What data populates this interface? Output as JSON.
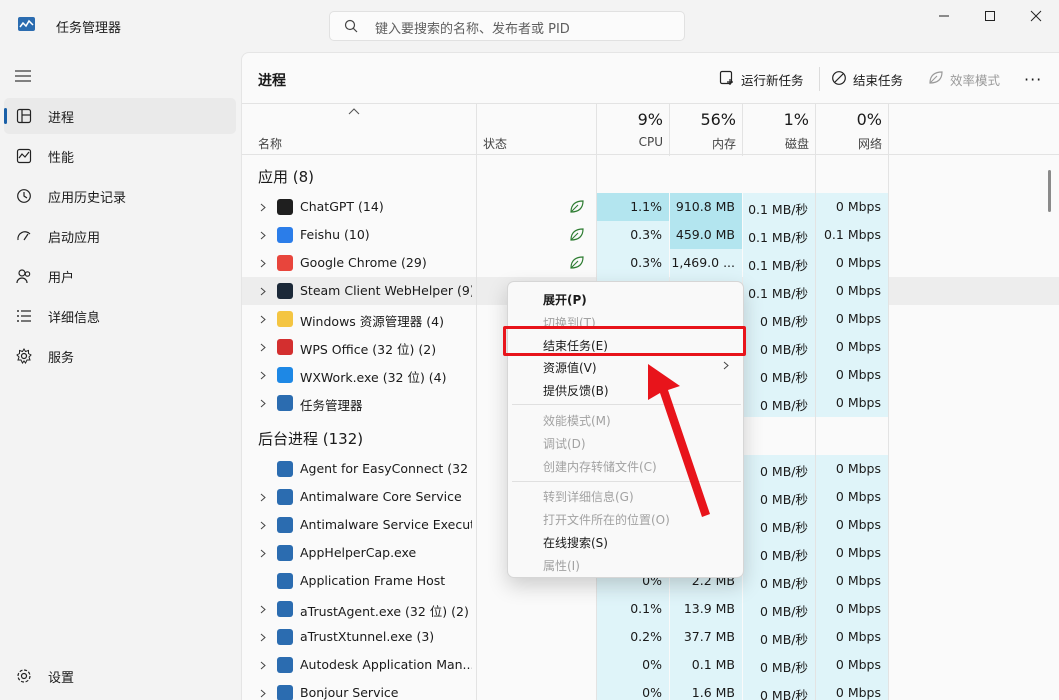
{
  "window": {
    "title": "任务管理器"
  },
  "search": {
    "placeholder": "键入要搜索的名称、发布者或 PID"
  },
  "sidebar": {
    "items": [
      {
        "label": "进程",
        "icon": "processes-icon",
        "active": true
      },
      {
        "label": "性能",
        "icon": "performance-icon"
      },
      {
        "label": "应用历史记录",
        "icon": "history-icon"
      },
      {
        "label": "启动应用",
        "icon": "startup-icon"
      },
      {
        "label": "用户",
        "icon": "users-icon"
      },
      {
        "label": "详细信息",
        "icon": "details-icon"
      },
      {
        "label": "服务",
        "icon": "services-icon"
      }
    ],
    "settings": "设置"
  },
  "main": {
    "title": "进程",
    "toolbar": {
      "run_new_task": "运行新任务",
      "end_task": "结束任务",
      "efficiency_mode": "效率模式",
      "more": "···"
    }
  },
  "columns": {
    "name": "名称",
    "status": "状态",
    "cpu": {
      "pct": "9%",
      "label": "CPU"
    },
    "memory": {
      "pct": "56%",
      "label": "内存"
    },
    "disk": {
      "pct": "1%",
      "label": "磁盘"
    },
    "network": {
      "pct": "0%",
      "label": "网络"
    }
  },
  "groups": {
    "apps": "应用 (8)",
    "background": "后台进程 (132)"
  },
  "apps": [
    {
      "name": "ChatGPT (14)",
      "cpu": "1.1%",
      "mem": "910.8 MB",
      "disk": "0.1 MB/秒",
      "net": "0 Mbps",
      "status": true
    },
    {
      "name": "Feishu (10)",
      "cpu": "0.3%",
      "mem": "459.0 MB",
      "disk": "0.1 MB/秒",
      "net": "0.1 Mbps",
      "status": true
    },
    {
      "name": "Google Chrome (29)",
      "cpu": "0.3%",
      "mem": "1,469.0 ...",
      "disk": "0.1 MB/秒",
      "net": "0 Mbps",
      "status": true
    },
    {
      "name": "Steam Client WebHelper (9)",
      "cpu": "",
      "mem": "",
      "disk": "0.1 MB/秒",
      "net": "0 Mbps"
    },
    {
      "name": "Windows 资源管理器 (4)",
      "cpu": "",
      "mem": "",
      "disk": "0 MB/秒",
      "net": "0 Mbps"
    },
    {
      "name": "WPS Office (32 位) (2)",
      "cpu": "",
      "mem": "",
      "disk": "0 MB/秒",
      "net": "0 Mbps"
    },
    {
      "name": "WXWork.exe (32 位) (4)",
      "cpu": "",
      "mem": "",
      "disk": "0 MB/秒",
      "net": "0 Mbps"
    },
    {
      "name": "任务管理器",
      "cpu": "",
      "mem": "",
      "disk": "0 MB/秒",
      "net": "0 Mbps"
    }
  ],
  "background": [
    {
      "name": "Agent for EasyConnect (32 ...",
      "cpu": "",
      "mem": "",
      "disk": "0 MB/秒",
      "net": "0 Mbps"
    },
    {
      "name": "Antimalware Core Service",
      "cpu": "",
      "mem": "",
      "disk": "0 MB/秒",
      "net": "0 Mbps"
    },
    {
      "name": "Antimalware Service Execut...",
      "cpu": "",
      "mem": "",
      "disk": "0 MB/秒",
      "net": "0 Mbps"
    },
    {
      "name": "AppHelperCap.exe",
      "cpu": "",
      "mem": "",
      "disk": "0 MB/秒",
      "net": "0 Mbps"
    },
    {
      "name": "Application Frame Host",
      "cpu": "0%",
      "mem": "2.2 MB",
      "disk": "0 MB/秒",
      "net": "0 Mbps"
    },
    {
      "name": "aTrustAgent.exe (32 位) (2)",
      "cpu": "0.1%",
      "mem": "13.9 MB",
      "disk": "0 MB/秒",
      "net": "0 Mbps"
    },
    {
      "name": "aTrustXtunnel.exe (3)",
      "cpu": "0.2%",
      "mem": "37.7 MB",
      "disk": "0 MB/秒",
      "net": "0 Mbps"
    },
    {
      "name": "Autodesk Application Man...",
      "cpu": "0%",
      "mem": "0.1 MB",
      "disk": "0 MB/秒",
      "net": "0 Mbps"
    },
    {
      "name": "Bonjour Service",
      "cpu": "0%",
      "mem": "1.6 MB",
      "disk": "0 MB/秒",
      "net": "0 Mbps"
    }
  ],
  "context_menu": {
    "expand": "展开(P)",
    "switch_to": "切换到(T)",
    "end_task": "结束任务(E)",
    "resource_values": "资源值(V)",
    "feedback": "提供反馈(B)",
    "efficiency_mode": "效能模式(M)",
    "debug": "调试(D)",
    "create_dump": "创建内存转储文件(C)",
    "go_to_details": "转到详细信息(G)",
    "open_file_location": "打开文件所在的位置(O)",
    "search_online": "在线搜索(S)",
    "properties": "属性(I)"
  },
  "colors": {
    "accent": "#1a60a8",
    "heat_high": "#b3e5ef",
    "heat_mid": "#c8ecf4",
    "heat_low": "#dff4f9",
    "annotation": "#e8141b"
  }
}
